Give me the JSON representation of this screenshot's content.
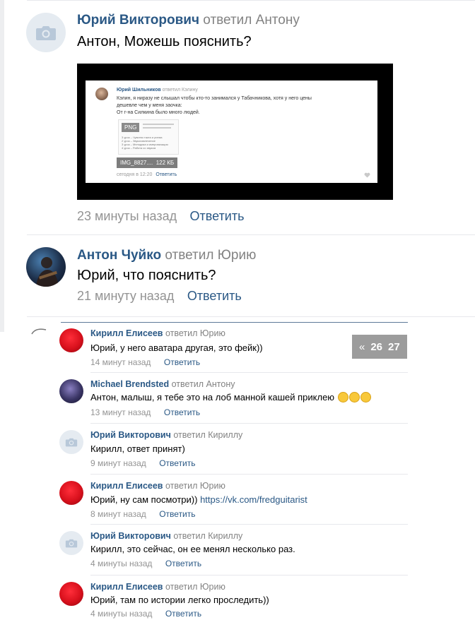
{
  "comments_top": [
    {
      "author": "Юрий Викторович",
      "action": "ответил Антону",
      "text": "Антон, Можешь пояснить?",
      "time": "23 минуты назад",
      "reply": "Ответить",
      "avatar": "camera-icon"
    },
    {
      "author": "Антон Чуйко",
      "action": "ответил Юрию",
      "text": "Юрий, что пояснить?",
      "time": "21 минуту назад",
      "reply": "Ответить",
      "avatar": "photo"
    }
  ],
  "embedded_screenshot": {
    "author": "Юрий Шильников",
    "action": "ответил Кэлину",
    "line1": "Кэлин, я ниразу не слышал чтобы кто-то занимался у Табачникова, хотя у него цены",
    "line2": "дешевле чем у меня заочка:",
    "line3": "От г-на Силкина было много людей.",
    "png": "PNG",
    "list": [
      "3 урок – Чувство такта и ритма",
      "2 урок – Звукоизвлечение",
      "3 урок – Мелодика и импровизация",
      "4 урок – Работа со звуком"
    ],
    "file_name": "IMG_8827....",
    "file_size": "122 КБ",
    "time": "сегодня в 12:20",
    "reply": "Ответить"
  },
  "pager": {
    "arrow": "«",
    "pages": [
      "26",
      "27"
    ]
  },
  "comments_bottom": [
    {
      "author": "Кирилл Елисеев",
      "action": "ответил Юрию",
      "text": "Юрий, у него аватара другая, это фейк))",
      "time": "14 минут назад",
      "reply": "Ответить"
    },
    {
      "author": "Michael Brendsted",
      "action": "ответил Антону",
      "text": "Антон, малыш, я тебе это на лоб манной кашей приклею",
      "time": "13 минут назад",
      "reply": "Ответить"
    },
    {
      "author": "Юрий Викторович",
      "action": "ответил Кириллу",
      "text": "Кирилл, ответ принят)",
      "time": "9 минут назад",
      "reply": "Ответить"
    },
    {
      "author": "Кирилл Елисеев",
      "action": "ответил Юрию",
      "text": "Юрий, ну сам посмотри))",
      "link": "https://vk.com/fredguitarist",
      "time": "8 минут назад",
      "reply": "Ответить"
    },
    {
      "author": "Юрий Викторович",
      "action": "ответил Кириллу",
      "text": "Кирилл, это сейчас, он ее менял несколько раз.",
      "time": "4 минуты назад",
      "reply": "Ответить"
    },
    {
      "author": "Кирилл Елисеев",
      "action": "ответил Юрию",
      "text": "Юрий, там по истории легко проследить))",
      "time": "4 минуты назад",
      "reply": "Ответить"
    }
  ]
}
